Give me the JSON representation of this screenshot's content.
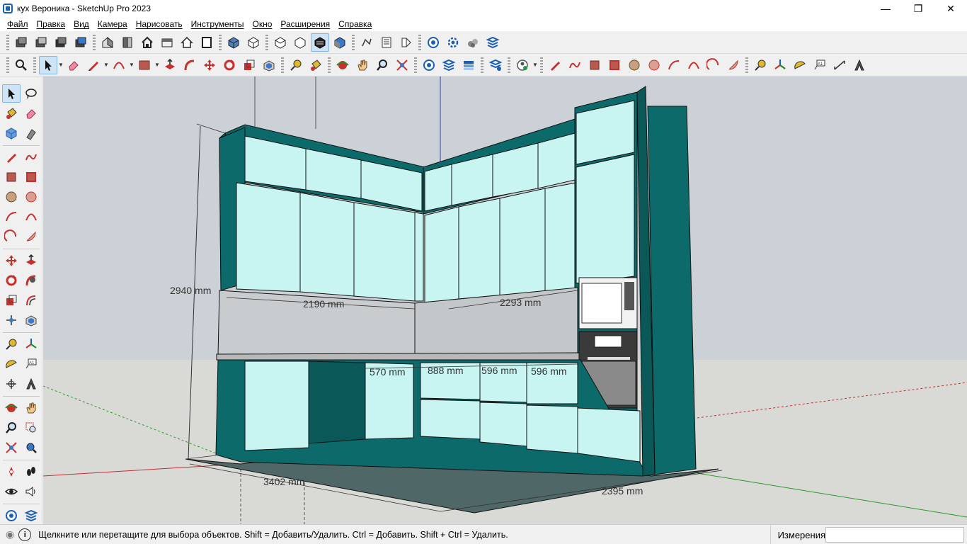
{
  "window": {
    "title": "кух Вероника - SketchUp Pro 2023",
    "controls": {
      "minimize": "—",
      "maximize": "❐",
      "close": "✕"
    }
  },
  "menu": [
    "Файл",
    "Правка",
    "Вид",
    "Камера",
    "Нарисовать",
    "Инструменты",
    "Окно",
    "Расширения",
    "Справка"
  ],
  "viewport": {
    "dimensions": {
      "height_total": "2940 mm",
      "upper_left_width": "2190 mm",
      "upper_right_width": "2293 mm",
      "base_570": "570 mm",
      "base_888": "888 mm",
      "base_596a": "596 mm",
      "base_596b": "596 mm",
      "floor_left": "3402 mm",
      "floor_right": "2395 mm"
    },
    "colors": {
      "sky": "#cbd1d6",
      "ground": "#d9d9d5",
      "carcass": "#0c6a6a",
      "fronts": "#c8f4f2",
      "backsplash": "#c9ccce",
      "floor_slab": "#4f6767"
    }
  },
  "status": {
    "message": "Щелкните или перетащите для выбора объектов. Shift = Добавить/Удалить. Ctrl = Добавить. Shift + Ctrl = Удалить.",
    "measure_label": "Измерения",
    "measure_value": ""
  },
  "toolbar_icons_row1": [
    "layer-icon",
    "layer-icon",
    "layer-icon",
    "layer-icon",
    "house-iso-icon",
    "front-view-icon",
    "home-icon",
    "top-view-icon",
    "home-outline-icon",
    "back-view-icon",
    "xray-icon",
    "wireframe-icon",
    "hidden-line-icon",
    "shaded-icon",
    "monochrome-icon",
    "textured-icon",
    "follow-me-icon",
    "components-icon",
    "section-icon",
    "warehouse-icon",
    "gear-icon",
    "extension-icon",
    "layers-icon"
  ],
  "toolbar_icons_row2": [
    "zoom-extents-icon",
    "select-icon",
    "eraser-icon",
    "pencil-icon",
    "arc-icon",
    "rectangle-icon",
    "push-pull-icon",
    "follow-me-icon",
    "move-icon",
    "rotate-icon",
    "scale-icon",
    "offset-icon",
    "tape-icon",
    "paint-icon",
    "orbit-icon",
    "pan-icon",
    "zoom-icon",
    "zoom-window-icon",
    "warehouse-icon",
    "layers-icon",
    "tags-icon",
    "model-info-icon",
    "account-icon",
    "line-icon",
    "freehand-icon",
    "rect-icon",
    "rotated-rect-icon",
    "circle-icon",
    "polygon-icon",
    "arc2-icon",
    "arc3-icon",
    "pie-icon",
    "measure-icon",
    "axes-icon",
    "protractor-icon",
    "text-icon",
    "dimension-icon",
    "3d-text-icon"
  ]
}
